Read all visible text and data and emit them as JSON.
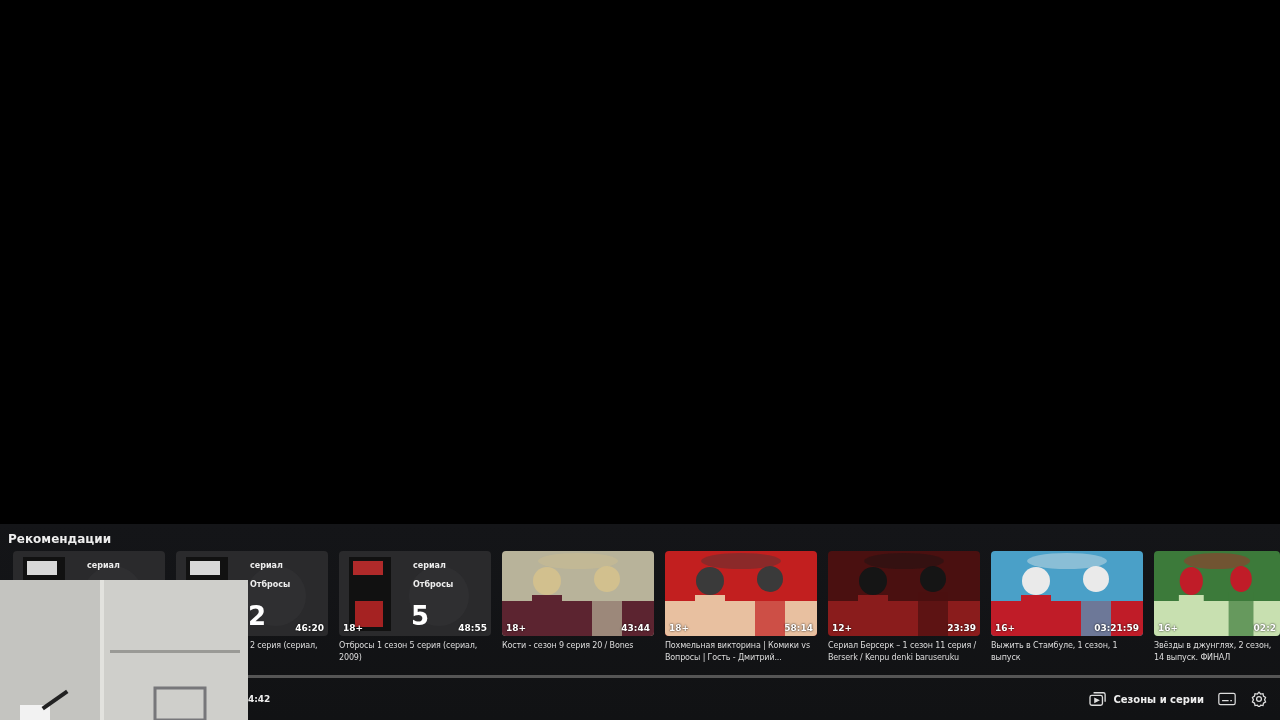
{
  "recommendations": {
    "title": "Рекомендации",
    "cards": [
      {
        "series_label": "сериал"
      },
      {
        "series_label": "сериал",
        "show_label": "Отбросы",
        "episode": "2",
        "duration": "46:20",
        "title": "2 серия (сериал,"
      },
      {
        "series_label": "сериал",
        "show_label": "Отбросы",
        "episode": "5",
        "age": "18+",
        "duration": "48:55",
        "title": "Отбросы 1 сезон 5 серия (сериал, 2009)"
      },
      {
        "age": "18+",
        "duration": "43:44",
        "title": "Кости - сезон 9 серия 20 / Bones"
      },
      {
        "age": "18+",
        "duration": "58:14",
        "title": "Похмельная викторина | Комики vs Вопросы | Гость - Дмитрий..."
      },
      {
        "age": "12+",
        "duration": "23:39",
        "title": "Сериал Берсерк – 1 сезон 11 серия / Berserk / Kenpu denki baruseruku"
      },
      {
        "age": "16+",
        "duration": "03:21:59",
        "title": "Выжить в Стамбуле, 1 сезон, 1 выпуск"
      },
      {
        "age": "16+",
        "duration": "02:2",
        "title": "Звёзды в джунглях, 2 сезон, 14 выпуск. ФИНАЛ"
      }
    ]
  },
  "controls": {
    "time": "4:42",
    "seasons_button": "Сезоны и серии"
  }
}
